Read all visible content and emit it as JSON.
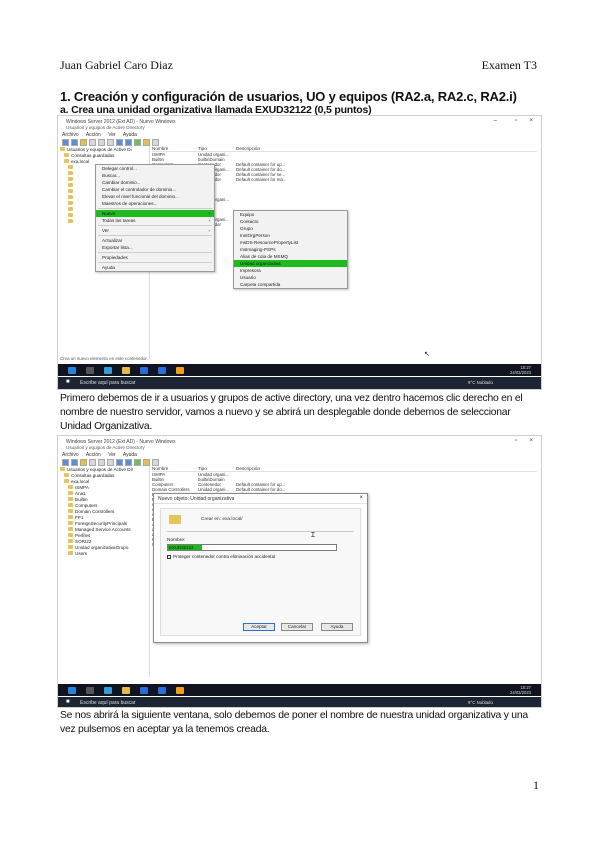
{
  "header": {
    "author": "Juan Gabriel Caro Diaz",
    "exam": "Examen T3"
  },
  "section": {
    "title": "1. Creación y configuración de usuarios, UO y equipos (RA2.a, RA2.c, RA2.i)",
    "subtitle": "a. Crea una unidad organizativa llamada EXUD32122 (0,5 puntos)"
  },
  "paragraphs": [
    "Primero debemos de ir a usuarios y grupos de active directory, una vez dentro hacemos clic derecho en el nombre de nuestro servidor, vamos a nuevo y se abrirá un desplegable donde debemos de seleccionar Unidad Organizativa.",
    "Se nos abrirá la siguiente ventana, solo debemos de poner el nombre de nuestra unidad organizativa y una vez pulsemos en aceptar ya la tenemos creada."
  ],
  "page_number": "1",
  "screenshot1": {
    "window_title": "Windows Server 2012 (Ext AD) - Nuevo Windows",
    "app_title": "Usuarios y equipos de Active Directory",
    "menu": [
      "Archivo",
      "Acción",
      "Ver",
      "Ayuda"
    ],
    "tree": [
      "Usuarios y equipos de Active Di",
      "Consultas guardadas",
      "exa.local"
    ],
    "list_headers": [
      "Nombre",
      "Tipo",
      "Descripción"
    ],
    "list_rows": [
      {
        "name": "ISMPA",
        "type": "Unidad organi...",
        "desc": ""
      },
      {
        "name": "Builtin",
        "type": "builtinDomain",
        "desc": ""
      },
      {
        "name": "Computers",
        "type": "Contenedor",
        "desc": "Default container for up..."
      },
      {
        "name": "Domain Controllers",
        "type": "Unidad organi...",
        "desc": "Default container for do..."
      },
      {
        "name": "ForeignSecurityPr...",
        "type": "Contenedor",
        "desc": "Default container for se..."
      },
      {
        "name": "Managed Service",
        "type": "Contenedor",
        "desc": "Default container for ma..."
      },
      {
        "name": "usuario1",
        "type": "Usuario",
        "desc": ""
      },
      {
        "name": "usuario2",
        "type": "Usuario",
        "desc": ""
      },
      {
        "name": "usuario3",
        "type": "Usuario",
        "desc": ""
      },
      {
        "name": "EXUD32122",
        "type": "Unidad organi...",
        "desc": ""
      },
      {
        "name": "Ana1",
        "type": "Usuario",
        "desc": ""
      },
      {
        "name": "ana2",
        "type": "Usuario",
        "desc": ""
      },
      {
        "name": "ana3",
        "type": "Usuario",
        "desc": ""
      },
      {
        "name": "Unidad organizat...",
        "type": "Unidad organi...",
        "desc": ""
      },
      {
        "name": "Users",
        "type": "Contenedor",
        "desc": "Default container for up..."
      }
    ],
    "context_menu": [
      "Delegar control...",
      "Buscar...",
      "Cambiar dominio...",
      "Cambiar el controlador de dominio...",
      "Elevar el nivel funcional del dominio...",
      "Maestros de operaciones...",
      "Nuevo",
      "Todas las tareas",
      "Ver",
      "Actualizar",
      "Exportar lista...",
      "Propiedades",
      "Ayuda"
    ],
    "context_highlight": "Nuevo",
    "submenu": [
      "Equipo",
      "Contacto",
      "Grupo",
      "InetOrgPerson",
      "msDS-ResourcePropertyList",
      "msImaging-PSPs",
      "Alias de cola de MSMQ",
      "Unidad organizativa",
      "Impresora",
      "Usuario",
      "Carpeta compartida"
    ],
    "submenu_highlight": "Unidad organizativa",
    "status_text": "Crea un nuevo elemento en este contenedor.",
    "search_text": "Escribe aquí para buscar",
    "tray_weather": "9°C Nublado",
    "tray_time": "10:27",
    "tray_date": "24/03/2023"
  },
  "screenshot2": {
    "window_title": "Windows Server 2012 (Ext AD) - Nuevo Windows",
    "app_title": "Usuarios y equipos de Active Directory",
    "menu": [
      "Archivo",
      "Acción",
      "Ver",
      "Ayuda"
    ],
    "tree": [
      "Usuarios y equipos de Active Dir",
      "Consultas guardadas",
      "exa.local",
      "ISMPA",
      "Ana1",
      "Builtin",
      "Computers",
      "Domain Controllers",
      "FP1",
      "ForeignSecurityPrincipals",
      "Managed Service Accounts",
      "Perfiles",
      "SORI22",
      "Unidad organizativaGrupo",
      "Users"
    ],
    "dialog_title": "Nuevo objeto: Unidad organizativa",
    "create_in_label": "Crear en:",
    "create_in_value": "exa.local/",
    "name_label": "Nombre:",
    "name_value": "EXUD32122",
    "protect_checkbox": "Proteger contenedor contra eliminación accidental",
    "buttons": [
      "Aceptar",
      "Cancelar",
      "Ayuda"
    ],
    "search_text": "Escribe aquí para buscar",
    "tray_weather": "9°C Nublado",
    "tray_time": "10:27",
    "tray_date": "24/03/2023"
  }
}
